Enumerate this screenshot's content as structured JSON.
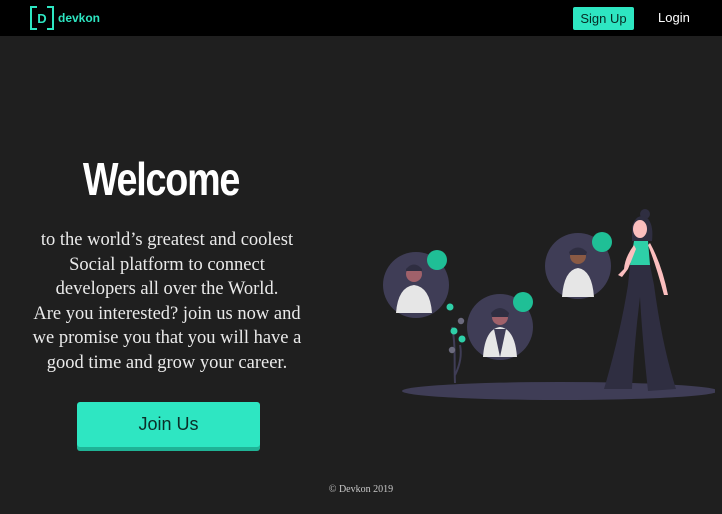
{
  "navbar": {
    "logo_letter": "D",
    "logo_text": "devkon",
    "signup_label": "Sign Up",
    "login_label": "Login"
  },
  "hero": {
    "title": "Welcome",
    "text_lines": [
      "to the world’s greatest and coolest",
      "Social platform to connect",
      "developers all over the World.",
      "Are you interested? join us now and",
      "we promise you that you will have a",
      "good time and grow your career."
    ],
    "join_label": "Join Us"
  },
  "footer": {
    "copyright": "© Devkon 2019"
  },
  "colors": {
    "accent": "#2ee6c2",
    "background": "#1f1f1f",
    "navbar": "#000000",
    "avatar_bg": "#3f3d56"
  },
  "icons": [
    "logo-bracket-icon",
    "people-illustration"
  ]
}
